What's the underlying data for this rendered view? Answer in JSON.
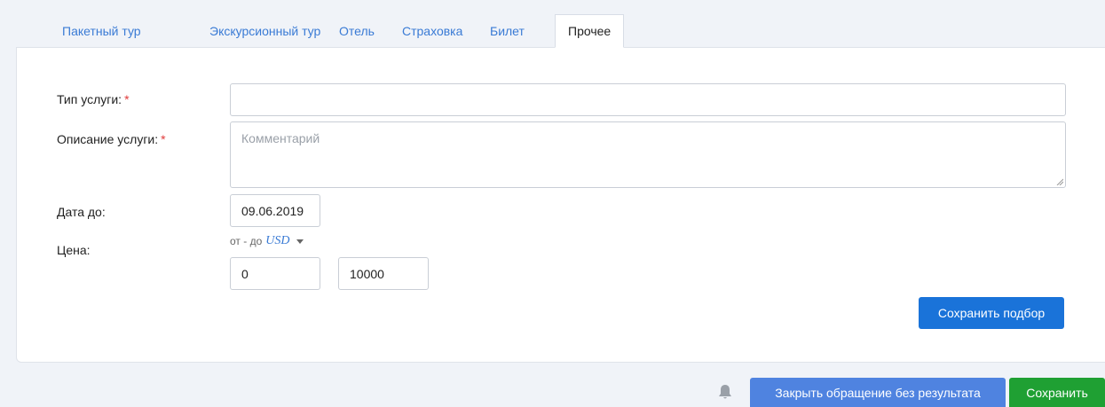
{
  "tabs": [
    {
      "label": "Пакетный тур"
    },
    {
      "label": "Экскурсионный тур"
    },
    {
      "label": "Отель"
    },
    {
      "label": "Страховка"
    },
    {
      "label": "Билет"
    },
    {
      "label": "Прочее"
    }
  ],
  "form": {
    "service_type_label": "Тип услуги:",
    "required_mark": "*",
    "service_type_value": "",
    "description_label": "Описание услуги:",
    "description_placeholder": "Комментарий",
    "date_label": "Дата до:",
    "date_value": "09.06.2019",
    "price_label": "Цена:",
    "price_range_hint": "от - до",
    "currency": "USD",
    "price_from": "0",
    "price_to": "10000"
  },
  "buttons": {
    "save_selection": "Сохранить подбор",
    "close_without_result": "Закрыть обращение без результата",
    "save": "Сохранить"
  },
  "icons": {
    "bell": "bell-icon"
  },
  "colors": {
    "link_blue": "#3a7bd5",
    "primary_blue": "#1a73d9",
    "close_blue": "#4f83e0",
    "save_green": "#1fa033",
    "required_red": "#e03b3b"
  }
}
